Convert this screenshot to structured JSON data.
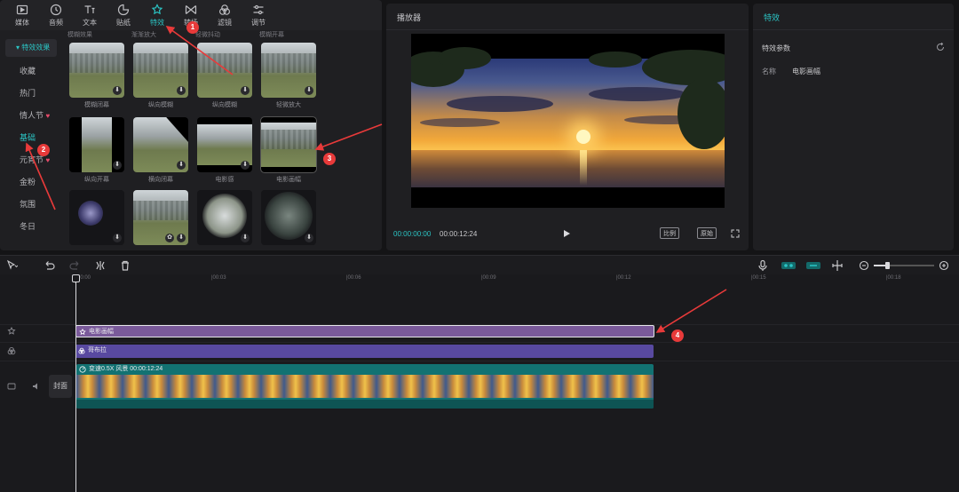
{
  "toolbar": {
    "items": [
      {
        "label": "媒体",
        "icon": "media-icon"
      },
      {
        "label": "音频",
        "icon": "audio-icon"
      },
      {
        "label": "文本",
        "icon": "text-icon"
      },
      {
        "label": "贴纸",
        "icon": "sticker-icon"
      },
      {
        "label": "特效",
        "icon": "effects-icon"
      },
      {
        "label": "转场",
        "icon": "transition-icon"
      },
      {
        "label": "滤镜",
        "icon": "filter-icon"
      },
      {
        "label": "调节",
        "icon": "adjust-icon"
      }
    ],
    "active": "特效"
  },
  "categories": {
    "header": "▾ 特效效果",
    "items": [
      "收藏",
      "热门",
      "情人节",
      "基础",
      "元宵节",
      "金粉",
      "氛围",
      "冬日"
    ],
    "active": "基础",
    "heart": "♥"
  },
  "effects_grid": {
    "top_labels": [
      "模糊效果",
      "渐渐放大",
      "轻微抖动",
      "模糊开幕"
    ],
    "rows": [
      [
        {
          "label": "模糊闭幕"
        },
        {
          "label": "纵向模糊"
        },
        {
          "label": "纵向模糊"
        },
        {
          "label": "轻微放大"
        }
      ],
      [
        {
          "label": "纵向开幕"
        },
        {
          "label": "横向闭幕"
        },
        {
          "label": "电影感"
        },
        {
          "label": "电影画幅"
        }
      ],
      [
        {
          "label": ""
        },
        {
          "label": ""
        },
        {
          "label": ""
        },
        {
          "label": ""
        }
      ]
    ],
    "download_glyph": "⬇"
  },
  "player": {
    "title": "播放器",
    "current_time": "00:00:00:00",
    "total_time": "00:00:12:24",
    "ratio_button": "比例",
    "original_button": "原始"
  },
  "settings": {
    "title": "特效",
    "params_title": "特效参数",
    "name_label": "名称",
    "name_value": "电影画幅"
  },
  "timeline": {
    "ruler_labels": [
      "00:00",
      "|00:03",
      "|00:06",
      "|00:09",
      "|00:12",
      "|00:15",
      "|00:18"
    ],
    "effect_clip": "电影画幅",
    "filter_clip": "哥布拉",
    "video_clip": "变速0.5X   风景   00:00:12:24",
    "cover_label": "封面"
  },
  "annotations": [
    "1",
    "2",
    "3",
    "4"
  ],
  "colors": {
    "accent": "#2bc4c4",
    "effect_clip": "#7a5a9a",
    "filter_clip": "#5849a0",
    "video_clip": "#127272",
    "marker": "#e83a3a"
  }
}
